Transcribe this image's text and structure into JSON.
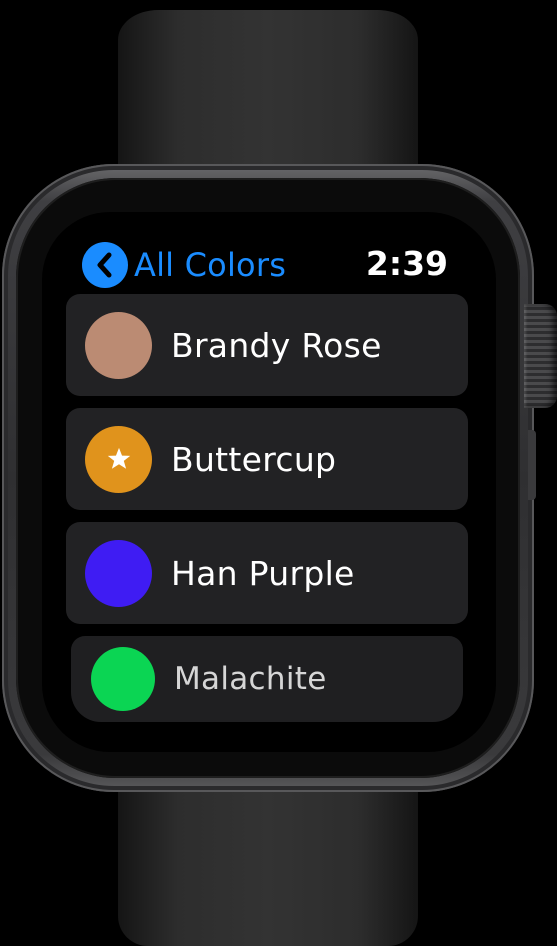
{
  "header": {
    "back_label": "All Colors",
    "time": "2:39"
  },
  "colors": [
    {
      "name": "Brandy Rose",
      "color": "#bb8b73",
      "favorite": false
    },
    {
      "name": "Buttercup",
      "color": "#e0931c",
      "favorite": true
    },
    {
      "name": "Han Purple",
      "color": "#3f1cf3",
      "favorite": false
    },
    {
      "name": "Malachite",
      "color": "#0bd553",
      "favorite": false
    }
  ],
  "icons": {
    "back": "chevron-left-icon",
    "favorite": "star-icon"
  },
  "device": "Apple Watch"
}
